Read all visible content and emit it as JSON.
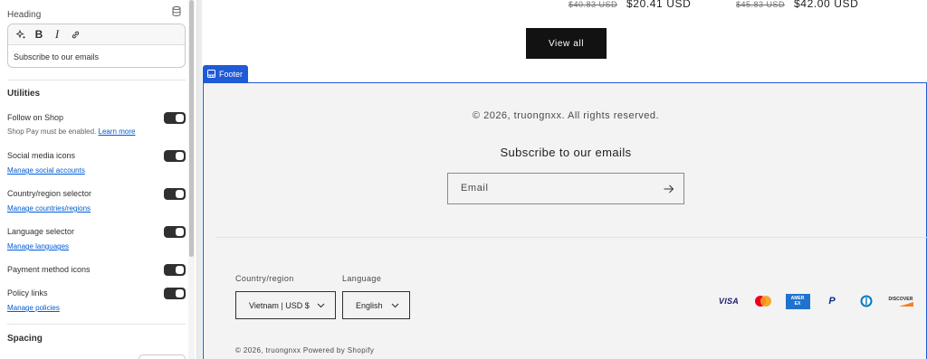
{
  "sidebar": {
    "heading_label": "Heading",
    "editor_text": "Subscribe to our emails",
    "toolbar": {
      "bold": "B",
      "italic": "I"
    },
    "utilities_title": "Utilities",
    "settings": [
      {
        "label": "Follow on Shop",
        "help": "Shop Pay must be enabled.",
        "link": "Learn more",
        "enabled": true
      },
      {
        "label": "Social media icons",
        "link": "Manage social accounts",
        "enabled": true
      },
      {
        "label": "Country/region selector",
        "link": "Manage countries/regions",
        "enabled": true
      },
      {
        "label": "Language selector",
        "link": "Manage languages",
        "enabled": true
      },
      {
        "label": "Payment method icons",
        "enabled": true
      },
      {
        "label": "Policy links",
        "link": "Manage policies",
        "enabled": true
      }
    ],
    "spacing_title": "Spacing"
  },
  "preview": {
    "prices": [
      {
        "old": "$40.83 USD",
        "new": "$20.41 USD"
      },
      {
        "old": "$45.83 USD",
        "new": "$42.00 USD"
      }
    ],
    "view_all_label": "View all",
    "footer_tag": "Footer",
    "footer": {
      "copyright": "© 2026, truongnxx. All rights reserved.",
      "subscribe_heading": "Subscribe to our emails",
      "email_placeholder": "Email",
      "country_label": "Country/region",
      "country_value": "Vietnam | USD $",
      "language_label": "Language",
      "language_value": "English",
      "payment_icons": [
        "visa-icon",
        "mastercard-icon",
        "amex-icon",
        "paypal-icon",
        "diners-club-icon",
        "discover-icon"
      ],
      "payment_texts": {
        "visa": "VISA",
        "amex_line1": "AMER",
        "amex_line2": "EX",
        "paypal": "P",
        "discover": "DISCOVER"
      },
      "bottom_text": "© 2026, truongnxx Powered by Shopify"
    }
  },
  "colors": {
    "accent": "#1f5ad7",
    "link": "#005bd3",
    "button_dark": "#121212",
    "toggle_on": "#303030"
  }
}
